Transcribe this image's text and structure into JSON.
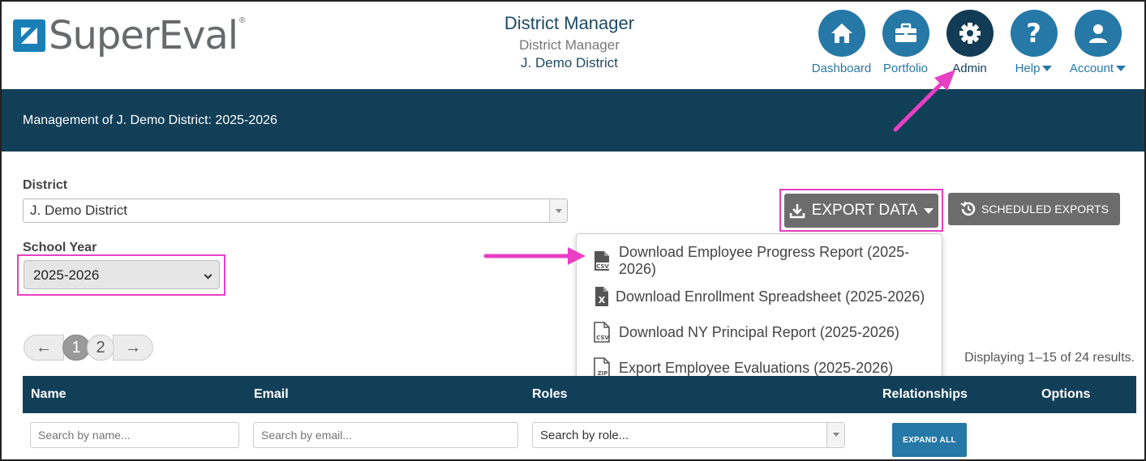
{
  "header": {
    "logo_text": "SuperEval",
    "logo_tm": "®",
    "title": "District Manager",
    "role": "District Manager",
    "district": "J. Demo District"
  },
  "nav": [
    {
      "label": "Dashboard",
      "icon": "home-icon",
      "active": false,
      "has_caret": false
    },
    {
      "label": "Portfolio",
      "icon": "briefcase-icon",
      "active": false,
      "has_caret": false
    },
    {
      "label": "Admin",
      "icon": "gear-icon",
      "active": true,
      "has_caret": false
    },
    {
      "label": "Help",
      "icon": "question-icon",
      "active": false,
      "has_caret": true
    },
    {
      "label": "Account",
      "icon": "user-icon",
      "active": false,
      "has_caret": true
    }
  ],
  "banner": {
    "text": "Management of J. Demo District: 2025-2026"
  },
  "filters": {
    "district_label": "District",
    "district_value": "J. Demo District",
    "year_label": "School Year",
    "year_value": "2025-2026"
  },
  "export": {
    "export_label": "EXPORT DATA",
    "scheduled_label": "SCHEDULED EXPORTS",
    "menu": [
      {
        "label": "Download Employee Progress Report (2025-2026)",
        "icon": "csv-file-icon",
        "type": "csv-solid"
      },
      {
        "label": "Download Enrollment Spreadsheet (2025-2026)",
        "icon": "excel-file-icon",
        "type": "xls"
      },
      {
        "label": "Download NY Principal Report (2025-2026)",
        "icon": "csv-file-icon",
        "type": "csv-outline"
      },
      {
        "label": "Export Employee Evaluations (2025-2026)",
        "icon": "zip-file-icon",
        "type": "zip"
      }
    ]
  },
  "pager": {
    "prev": "←",
    "pages": [
      "1",
      "2"
    ],
    "current": "1",
    "next": "→",
    "results": "Displaying 1–15 of 24 results."
  },
  "table": {
    "columns": [
      "Name",
      "Email",
      "Roles",
      "Relationships",
      "Options"
    ],
    "name_placeholder": "Search by name...",
    "email_placeholder": "Search by email...",
    "role_placeholder": "Search by role...",
    "expand_label": "EXPAND ALL"
  },
  "colors": {
    "brand_blue": "#2678a6",
    "navy": "#123f58",
    "highlight": "#e83fc4",
    "button_gray": "#6c6c6c"
  }
}
